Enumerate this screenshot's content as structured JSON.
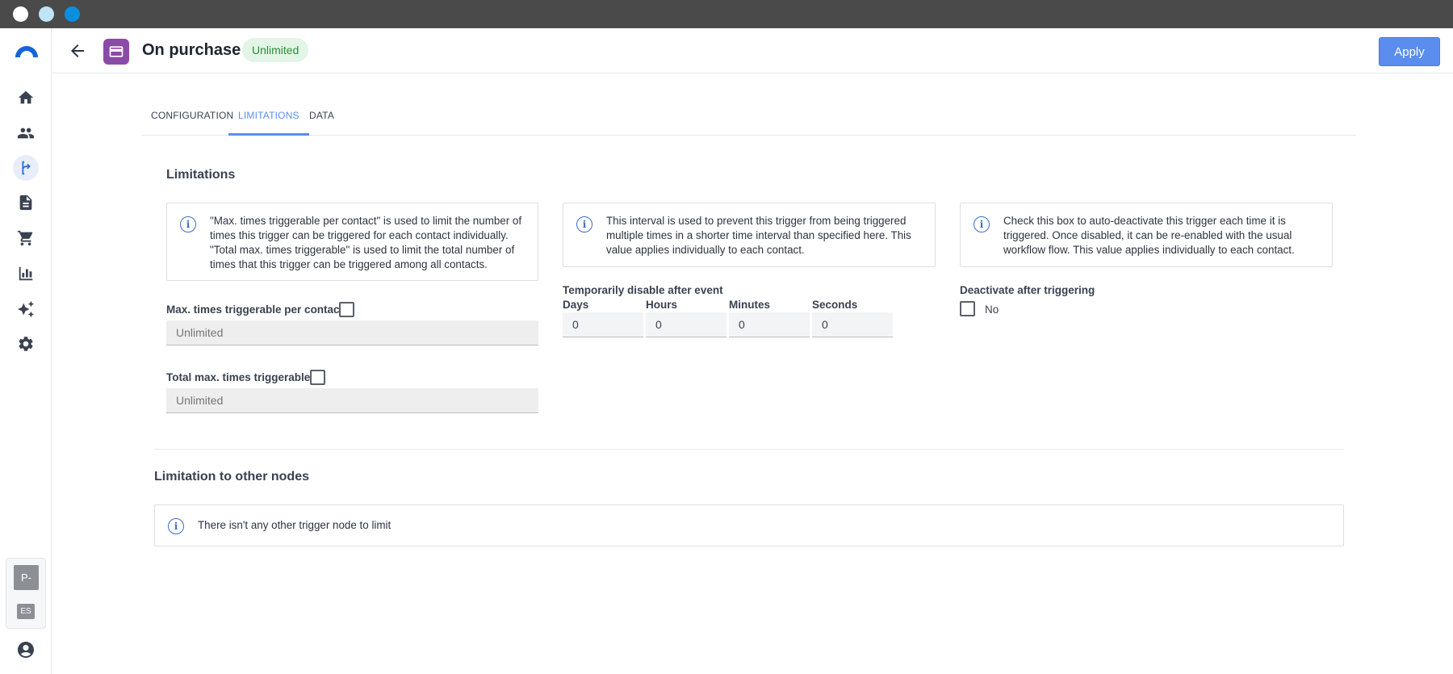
{
  "window": {
    "dots": [
      "close",
      "minimize",
      "maximize"
    ]
  },
  "sidebar": {
    "items": [
      {
        "icon": "home-icon"
      },
      {
        "icon": "contacts-icon"
      },
      {
        "icon": "workflow-icon",
        "active": true
      },
      {
        "icon": "document-icon"
      },
      {
        "icon": "cart-icon"
      },
      {
        "icon": "chart-icon"
      },
      {
        "icon": "sparkles-icon"
      },
      {
        "icon": "gear-icon"
      }
    ],
    "user_initial": "P-",
    "language": "ES"
  },
  "header": {
    "title": "On purchase",
    "badge": "Unlimited",
    "apply_label": "Apply"
  },
  "tabs": [
    {
      "label": "CONFIGURATION"
    },
    {
      "label": "LIMITATIONS",
      "active": true
    },
    {
      "label": "DATA"
    }
  ],
  "limitations": {
    "title": "Limitations",
    "info_max": "\"Max. times triggerable per contact\" is used to limit the number of times this trigger can be triggered for each contact individually. \"Total max. times triggerable\" is used to limit the total number of times that this trigger can be triggered among all contacts.",
    "info_interval": "This interval is used to prevent this trigger from being triggered multiple times in a shorter time interval than specified here. This value applies individually to each contact.",
    "info_deactivate": "Check this box to auto-deactivate this trigger each time it is triggered. Once disabled, it can be re-enabled with the usual workflow flow. This value applies individually to each contact.",
    "max_per_contact_label": "Max. times triggerable per contact",
    "max_per_contact_placeholder": "Unlimited",
    "total_max_label": "Total max. times triggerable",
    "total_max_placeholder": "Unlimited",
    "disable_label": "Temporarily disable after event",
    "days_label": "Days",
    "hours_label": "Hours",
    "minutes_label": "Minutes",
    "seconds_label": "Seconds",
    "days_value": "0",
    "hours_value": "0",
    "minutes_value": "0",
    "seconds_value": "0",
    "deactivate_label": "Deactivate after triggering",
    "deactivate_value": "No"
  },
  "other_nodes": {
    "title": "Limitation to other nodes",
    "message": "There isn't any other trigger node to limit"
  },
  "colors": {
    "accent": "#5b8def",
    "badge_bg": "#e3f5e6",
    "badge_text": "#2e8b3c",
    "trigger_icon": "#8a4aa8"
  }
}
